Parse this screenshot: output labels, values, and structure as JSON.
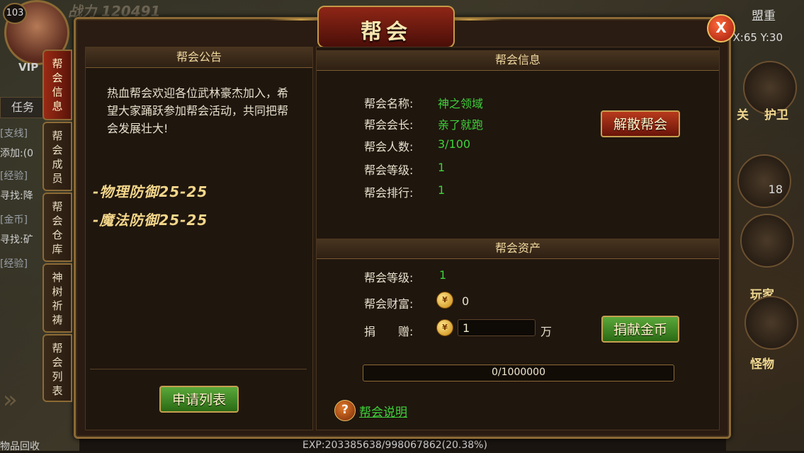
{
  "hud": {
    "level": "103",
    "vip": "VIP",
    "power": "战力 120491",
    "task": "任务",
    "lines": [
      "[支线]",
      "添加:(0",
      "[经验]",
      "寻找:降",
      "[金币]",
      "寻找:矿",
      "[经验]"
    ],
    "right_name": "盟重",
    "coords": "X:65 Y:30",
    "guard_label": "护卫",
    "guan_label": "关",
    "potion_count": "18",
    "player_label": "玩家",
    "monster_label": "怪物",
    "bottom_left": "物品回收",
    "exp": "EXP:203385638/998067862(20.38%)"
  },
  "window": {
    "title": "帮会",
    "close": "X"
  },
  "tabs": [
    {
      "label": "帮\n会\n信\n息",
      "active": true
    },
    {
      "label": "帮\n会\n成\n员",
      "active": false
    },
    {
      "label": "帮\n会\n仓\n库",
      "active": false
    },
    {
      "label": "神\n树\n祈\n祷",
      "active": false
    },
    {
      "label": "帮\n会\n列\n表",
      "active": false
    }
  ],
  "notice": {
    "header": "帮会公告",
    "text": "热血帮会欢迎各位武林豪杰加入，希望大家踊跃参加帮会活动，共同把帮会发展壮大!",
    "attr1": "-物理防御25-25",
    "attr2": "-魔法防御25-25",
    "apply_button": "申请列表"
  },
  "info": {
    "header": "帮会信息",
    "fields": [
      {
        "label": "帮会名称:",
        "value": "神之领域"
      },
      {
        "label": "帮会会长:",
        "value": "亲了就跑"
      },
      {
        "label": "帮会人数:",
        "value": "3/100"
      },
      {
        "label": "帮会等级:",
        "value": "1"
      },
      {
        "label": "帮会排行:",
        "value": "1"
      }
    ],
    "disband_button": "解散帮会"
  },
  "assets": {
    "header": "帮会资产",
    "level_label": "帮会等级:",
    "level_value": "1",
    "wealth_label": "帮会财富:",
    "wealth_value": "0",
    "donate_label": "捐　　赠:",
    "donate_value": "1",
    "donate_unit": "万",
    "donate_button": "捐献金币",
    "progress_text": "0/1000000",
    "help_icon": "?",
    "help_link": "帮会说明"
  },
  "colors": {
    "accent_green": "#3ed23a",
    "gold": "#f3d68a",
    "frame": "#8c6a35"
  }
}
